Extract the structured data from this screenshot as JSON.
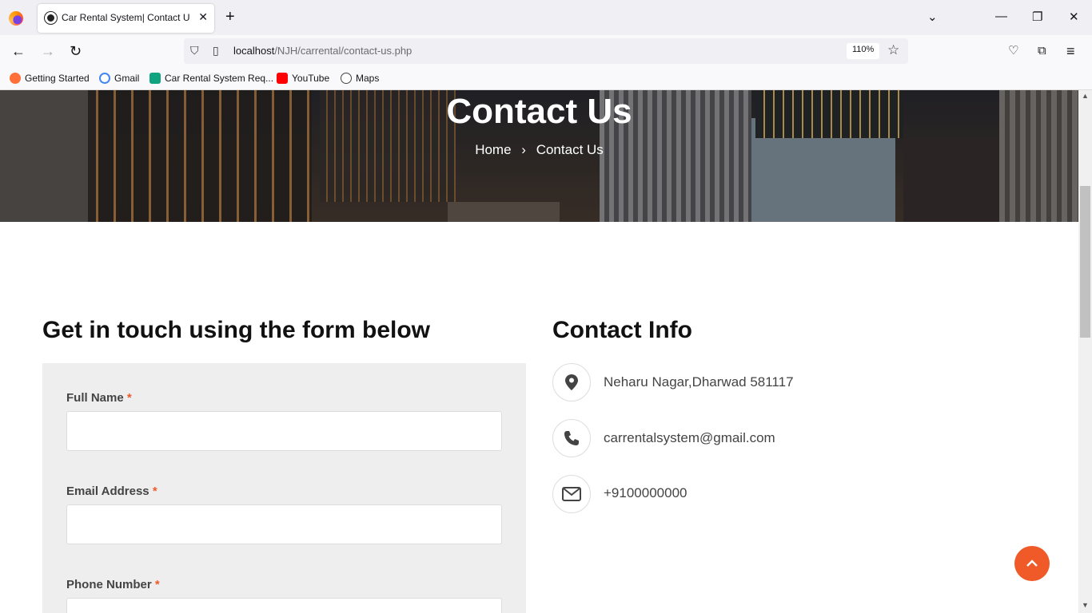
{
  "browser": {
    "tab_title": "Car Rental System| Contact Us I",
    "url_host": "localhost",
    "url_path": "/NJH/carrental/contact-us.php",
    "zoom": "110%",
    "bookmarks": [
      "Getting Started",
      "Gmail",
      "Car Rental System Req...",
      "YouTube",
      "Maps"
    ]
  },
  "hero": {
    "title": "Contact Us",
    "breadcrumb_home": "Home",
    "breadcrumb_sep": "›",
    "breadcrumb_current": "Contact Us"
  },
  "form": {
    "heading": "Get in touch using the form below",
    "full_name_label": "Full Name",
    "email_label": "Email Address",
    "phone_label": "Phone Number",
    "required_mark": "*"
  },
  "contact_info": {
    "heading": "Contact Info",
    "address": "Neharu Nagar,Dharwad 581117",
    "email": "carrentalsystem@gmail.com",
    "phone": "+9100000000"
  },
  "colors": {
    "accent": "#f05a28"
  }
}
